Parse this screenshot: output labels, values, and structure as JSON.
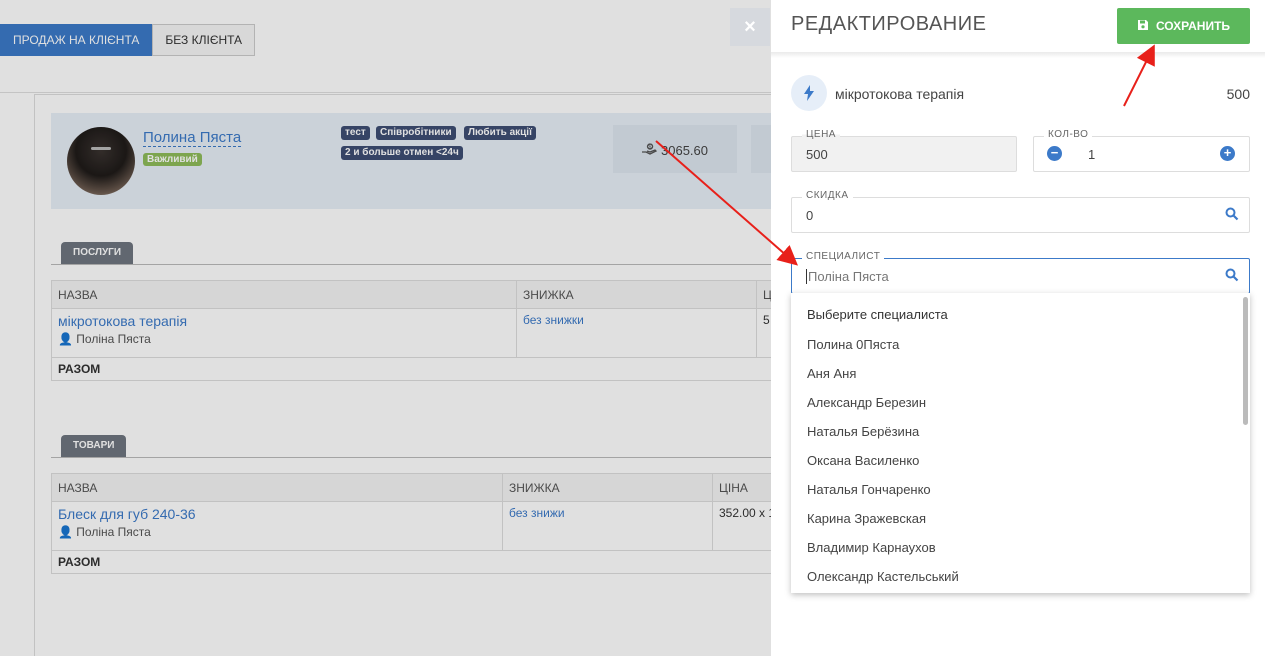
{
  "top_tabs": {
    "sale_with_client": "ПРОДАЖ НА КЛІЄНТА",
    "without_client": "БЕЗ КЛІЄНТА"
  },
  "client": {
    "name": "Полина Пяста",
    "status": "Важливий",
    "tags": [
      "тест",
      "Співробітники",
      "Любить акції",
      "2 и больше отмен <24ч"
    ],
    "balance": "3065.60"
  },
  "services_section": {
    "title": "ПОСЛУГИ",
    "columns": [
      "НАЗВА",
      "ЗНИЖКА",
      "Ц"
    ],
    "rows": [
      {
        "name": "мікротокова терапія",
        "specialist": "Поліна Пяста",
        "discount": "без знижки",
        "price": "5"
      }
    ],
    "total_label": "РАЗОМ"
  },
  "goods_section": {
    "title": "ТОВАРИ",
    "columns": [
      "НАЗВА",
      "ЗНИЖКА",
      "ЦІНА"
    ],
    "rows": [
      {
        "name": "Блеск для губ 240-36",
        "specialist": "Поліна Пяста",
        "discount": "без знижи",
        "price": "352.00 x 1"
      }
    ],
    "total_label": "РАЗОМ"
  },
  "close_label": "×",
  "panel": {
    "title": "РЕДАКТИРОВАНИЕ",
    "save_label": "СОХРАНИТЬ",
    "service_name": "мікротокова терапія",
    "service_price": "500",
    "price_label": "ЦЕНА",
    "price_value": "500",
    "qty_label": "КОЛ-ВО",
    "qty_value": "1",
    "discount_label": "СКИДКА",
    "discount_value": "0",
    "specialist_label": "СПЕЦИАЛИСТ",
    "specialist_placeholder": "Поліна Пяста",
    "specialist_options": [
      "Выберите специалиста",
      "Полина 0Пяста",
      "Аня Аня",
      "Александр Березин",
      "Наталья Берёзина",
      "Оксана Василенко",
      "Наталья Гончаренко",
      "Карина Зражевская",
      "Владимир Карнаухов",
      "Олександр Кастельський"
    ]
  },
  "colors": {
    "accent": "#3c7ac9",
    "save": "#5cb85c",
    "tag": "#3e4e74",
    "arrow": "#e8201a"
  }
}
